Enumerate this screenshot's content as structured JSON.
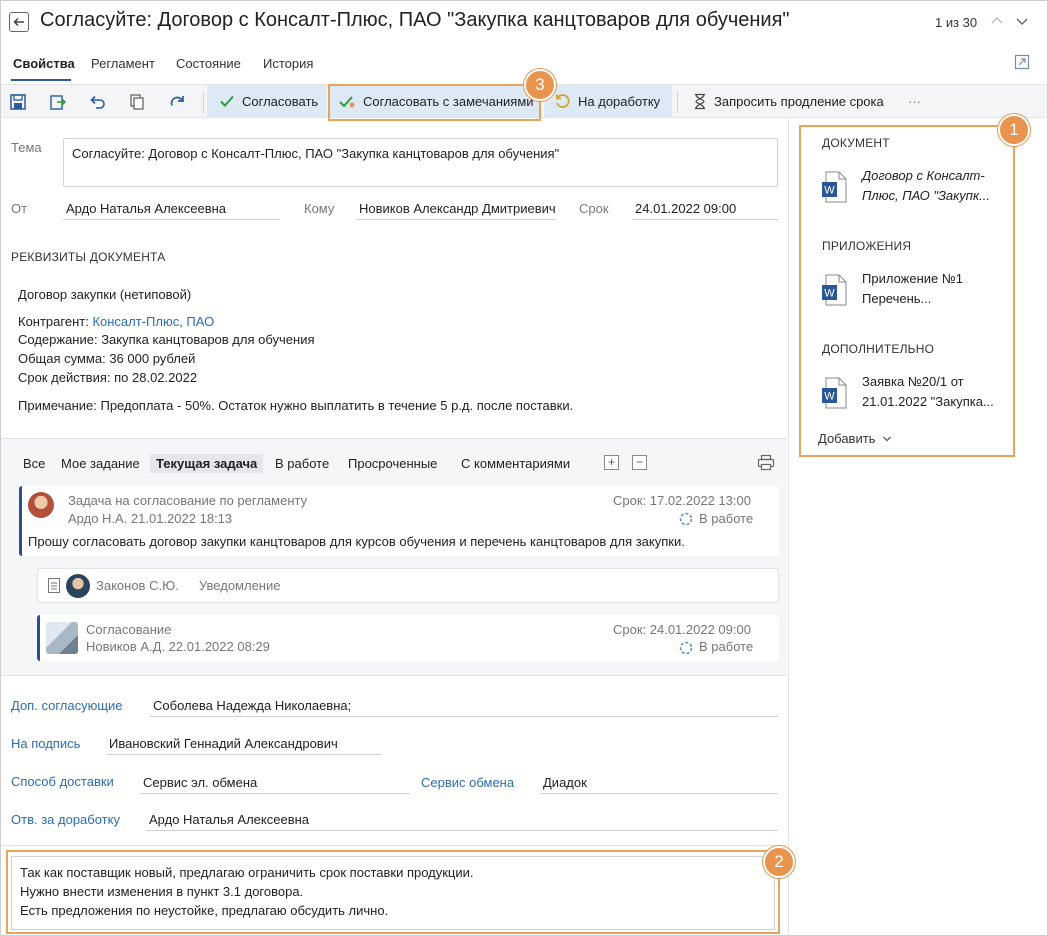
{
  "title": "Согласуйте: Договор с Консалт-Плюс, ПАО \"Закупка канцтоваров для обучения\"",
  "pager": "1 из 30",
  "tabs": [
    "Свойства",
    "Регламент",
    "Состояние",
    "История"
  ],
  "toolbar": {
    "approve": "Согласовать",
    "approve_with_remarks": "Согласовать с замечаниями",
    "rework": "На доработку",
    "extend": "Запросить продление срока",
    "more": "···"
  },
  "form": {
    "subject_label": "Тема",
    "subject": "Согласуйте: Договор с Консалт-Плюс, ПАО \"Закупка канцтоваров для обучения\"",
    "from_label": "От",
    "from": "Ардо Наталья Алексеевна",
    "to_label": "Кому",
    "to": "Новиков Александр Дмитриевич",
    "deadline_label": "Срок",
    "deadline": "24.01.2022 09:00"
  },
  "requisites": {
    "title": "РЕКВИЗИТЫ ДОКУМЕНТА",
    "doc_type": "Договор закупки (нетиповой)",
    "counterparty_label": "Контрагент: ",
    "counterparty": "Консалт-Плюс, ПАО",
    "content": "Содержание: Закупка канцтоваров для обучения",
    "amount": "Общая сумма: 36 000 рублей",
    "validity": "Срок действия: по 28.02.2022",
    "note": "Примечание: Предоплата - 50%. Остаток нужно выплатить в течение 5 р.д. после поставки."
  },
  "task_tabs": [
    "Все",
    "Мое задание",
    "Текущая задача",
    "В работе",
    "Просроченные",
    "С комментариями"
  ],
  "tasks": [
    {
      "title": "Задача на согласование по регламенту",
      "author": "Ардо Н.А.  21.01.2022 18:13",
      "deadline": "Срок: 17.02.2022 13:00",
      "status": "В работе",
      "body": "Прошу согласовать договор закупки канцтоваров для курсов обучения и перечень канцтоваров для закупки."
    },
    {
      "name": "Законов С.Ю.",
      "type": "Уведомление"
    },
    {
      "title": "Согласование",
      "author": "Новиков А.Д.  22.01.2022 08:29",
      "deadline": "Срок: 24.01.2022 09:00",
      "status": "В работе"
    }
  ],
  "extra": {
    "add_approvers_label": "Доп. согласующие",
    "add_approvers": "Соболева Надежда Николаевна;",
    "signer_label": "На подпись",
    "signer": "Ивановский Геннадий Александрович",
    "delivery_label": "Способ доставки",
    "delivery": "Сервис эл. обмена",
    "exchange_label": "Сервис обмена",
    "exchange": "Диадок",
    "rework_resp_label": "Отв. за доработку",
    "rework_resp": "Ардо Наталья Алексеевна"
  },
  "comment": [
    "Так как поставщик новый, предлагаю ограничить срок поставки продукции.",
    "Нужно внести изменения в пункт 3.1 договора.",
    "Есть предложения по неустойке, предлагаю обсудить лично."
  ],
  "right_panel": {
    "document_title": "ДОКУМЕНТ",
    "document_line1": "Договор с Консалт-",
    "document_line2": "Плюс, ПАО \"Закупк...",
    "attachments_title": "ПРИЛОЖЕНИЯ",
    "attachment_line1": "Приложение №1",
    "attachment_line2": "Перечень...",
    "additional_title": "ДОПОЛНИТЕЛЬНО",
    "additional_line1": "Заявка №20/1 от",
    "additional_line2": "21.01.2022 \"Закупка...",
    "add": "Добавить"
  },
  "badges": [
    "1",
    "2",
    "3"
  ],
  "colors": {
    "accent": "#2b5a9e",
    "link": "#2b6cb8",
    "highlight": "#e8a35c",
    "badge": "#e8944f"
  }
}
